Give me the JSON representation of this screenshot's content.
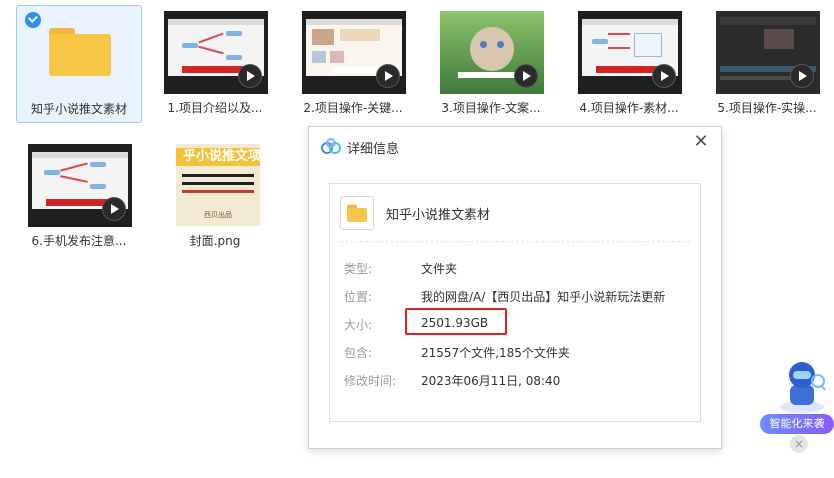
{
  "files": [
    {
      "name": "知乎小说推文素材",
      "type": "folder",
      "selected": true
    },
    {
      "name": "1.项目介绍以及...",
      "type": "video"
    },
    {
      "name": "2.项目操作-关键...",
      "type": "video"
    },
    {
      "name": "3.项目操作-文案...",
      "type": "video"
    },
    {
      "name": "4.项目操作-素材...",
      "type": "video"
    },
    {
      "name": "5.项目操作-实操...",
      "type": "video"
    },
    {
      "name": "6.手机发布注意...",
      "type": "video"
    },
    {
      "name": "封面.png",
      "type": "image"
    }
  ],
  "dialog": {
    "title": "详细信息",
    "item_name": "知乎小说推文素材",
    "rows": [
      {
        "label": "类型:",
        "value": "文件夹"
      },
      {
        "label": "位置:",
        "value": "我的网盘/A/【西贝出品】知乎小说新玩法更新"
      },
      {
        "label": "大小:",
        "value": "2501.93GB"
      },
      {
        "label": "包含:",
        "value": "21557个文件,185个文件夹"
      },
      {
        "label": "修改时间:",
        "value": "2023年06月11日, 08:40"
      }
    ],
    "close_symbol": "✕"
  },
  "cover_image_text": {
    "line1": "乎小说推文项",
    "line2": "可副业",
    "footer": "西贝出品"
  },
  "assistant": {
    "label": "智能化来袭",
    "close_symbol": "×"
  },
  "colors": {
    "accent": "#2e8ff2",
    "highlight": "#e02020",
    "folder": "#f7c646"
  }
}
